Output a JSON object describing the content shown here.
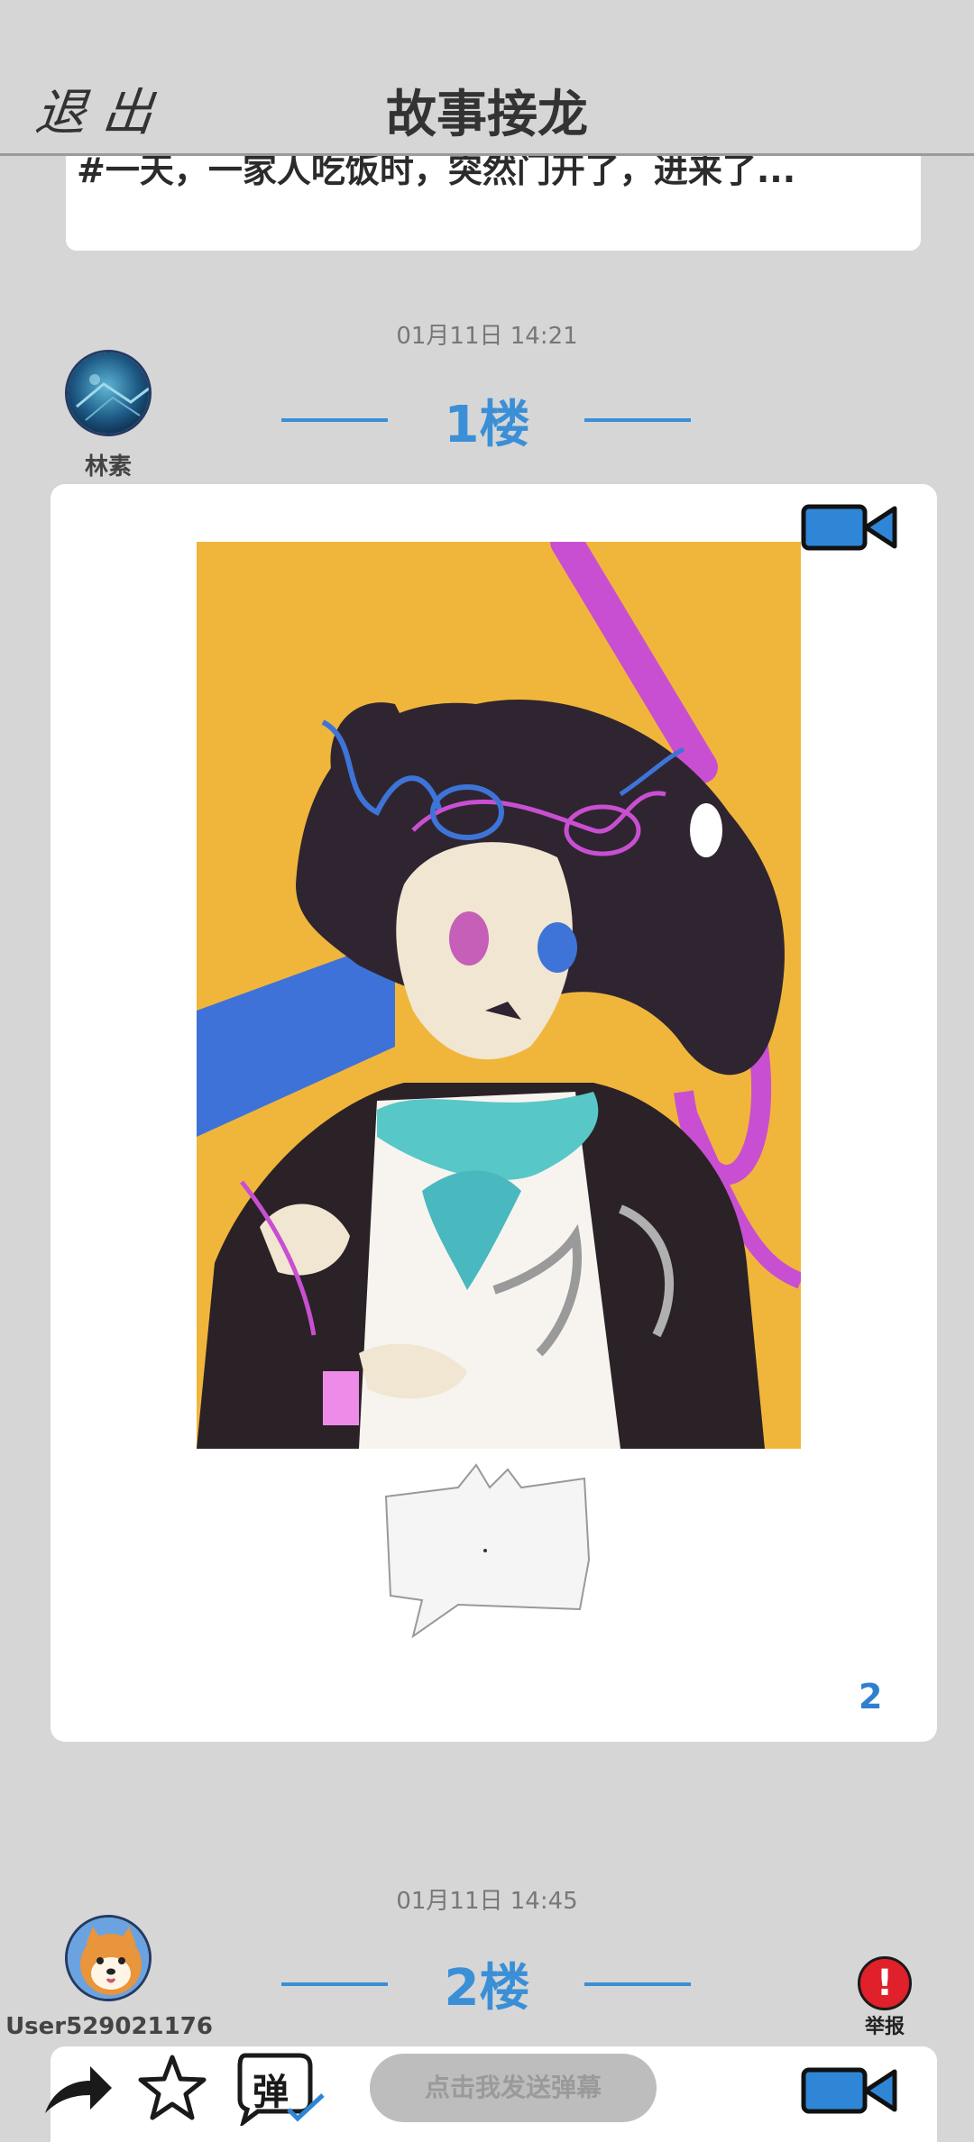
{
  "header": {
    "exit_label": "退出",
    "title": "故事接龙"
  },
  "top_snippet": {
    "text": "#一天，一家人吃饭时，突然门开了，进来了..."
  },
  "posts": [
    {
      "timestamp": "01月11日  14:21",
      "floor": "1楼",
      "user": "林素",
      "page_count": "2"
    },
    {
      "timestamp": "01月11日  14:45",
      "floor": "2楼",
      "user": "User529021176"
    }
  ],
  "report": {
    "icon": "exclamation-icon",
    "label": "举报"
  },
  "bottom_bar": {
    "danmaku_placeholder": "点击我发送弹幕",
    "danmaku_icon_char": "弹",
    "icons": [
      "share-icon",
      "star-icon",
      "danmaku-toggle-icon",
      "video-camera-icon"
    ]
  },
  "colors": {
    "accent": "#3b8fd6",
    "background": "#d6d6d6",
    "drawing_bg": "#f0b63c",
    "report": "#e0202a"
  }
}
